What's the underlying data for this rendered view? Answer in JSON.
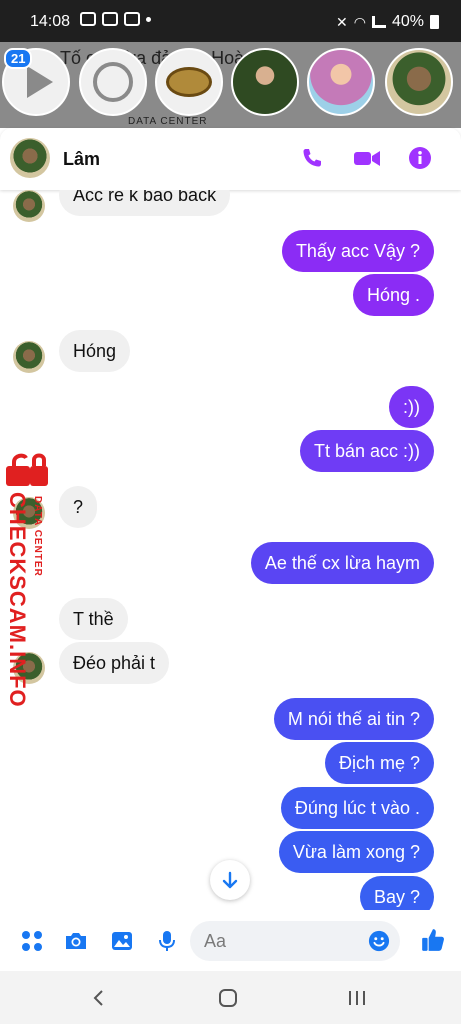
{
  "status_bar": {
    "time": "14:08",
    "battery": "40%"
  },
  "chat_heads": {
    "badge_count": "21",
    "bg_text": "Tố cáo lừa đảo Lê Hoàng T...",
    "bg_small": "DATA CENTER"
  },
  "header": {
    "name": "Lâm"
  },
  "messages": [
    {
      "dir": "in",
      "text": "Acc re k bao back"
    },
    {
      "dir": "out",
      "text": "Thấy acc Vậy ?"
    },
    {
      "dir": "out",
      "text": "Hóng ."
    },
    {
      "dir": "in",
      "text": "Hóng"
    },
    {
      "dir": "out",
      "text": ":))"
    },
    {
      "dir": "out",
      "text": "Tt bán acc :))"
    },
    {
      "dir": "in",
      "text": "?"
    },
    {
      "dir": "out",
      "text": "Ae thế cx lừa haym"
    },
    {
      "dir": "in",
      "text": "T thề"
    },
    {
      "dir": "in",
      "text": "Đéo phải t"
    },
    {
      "dir": "out",
      "text": "M nói thế ai tin ?"
    },
    {
      "dir": "out",
      "text": "Địch mẹ ?"
    },
    {
      "dir": "out",
      "text": "Đúng lúc t vào ."
    },
    {
      "dir": "out",
      "text": "Vừa làm xong ?"
    },
    {
      "dir": "out",
      "text": "Bay ?"
    }
  ],
  "watermark": {
    "text": "CHECKSCAM.INFO",
    "sub": "DATA CENTER"
  },
  "composer": {
    "placeholder": "Aa"
  },
  "colors": {
    "accent": "#a033ff",
    "purple": "#8b2cf5",
    "blue": "#3b5cf2",
    "incoming": "#f0f0f0"
  }
}
